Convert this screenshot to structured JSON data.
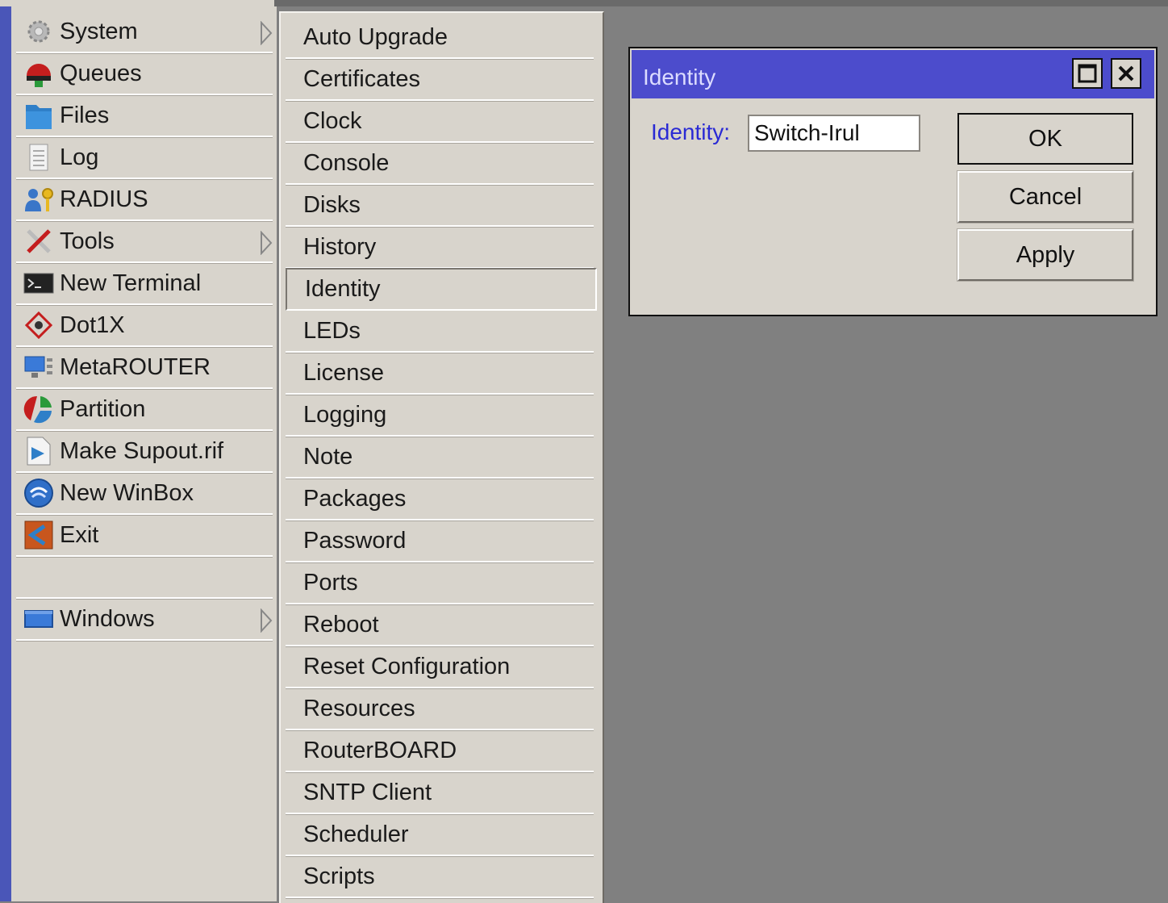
{
  "main_menu": {
    "items": [
      {
        "label": "System",
        "icon": "gear-icon",
        "has_submenu": true
      },
      {
        "label": "Queues",
        "icon": "queues-icon",
        "has_submenu": false
      },
      {
        "label": "Files",
        "icon": "folder-icon",
        "has_submenu": false
      },
      {
        "label": "Log",
        "icon": "log-icon",
        "has_submenu": false
      },
      {
        "label": "RADIUS",
        "icon": "radius-icon",
        "has_submenu": false
      },
      {
        "label": "Tools",
        "icon": "tools-icon",
        "has_submenu": true
      },
      {
        "label": "New Terminal",
        "icon": "terminal-icon",
        "has_submenu": false
      },
      {
        "label": "Dot1X",
        "icon": "dot1x-icon",
        "has_submenu": false
      },
      {
        "label": "MetaROUTER",
        "icon": "metarouter-icon",
        "has_submenu": false
      },
      {
        "label": "Partition",
        "icon": "partition-icon",
        "has_submenu": false
      },
      {
        "label": "Make Supout.rif",
        "icon": "supout-icon",
        "has_submenu": false
      },
      {
        "label": "New WinBox",
        "icon": "winbox-icon",
        "has_submenu": false
      },
      {
        "label": "Exit",
        "icon": "exit-icon",
        "has_submenu": false
      },
      {
        "label": "Windows",
        "icon": "windows-icon",
        "has_submenu": true
      }
    ]
  },
  "system_submenu": {
    "items": [
      "Auto Upgrade",
      "Certificates",
      "Clock",
      "Console",
      "Disks",
      "History",
      "Identity",
      "LEDs",
      "License",
      "Logging",
      "Note",
      "Packages",
      "Password",
      "Ports",
      "Reboot",
      "Reset Configuration",
      "Resources",
      "RouterBOARD",
      "SNTP Client",
      "Scheduler",
      "Scripts"
    ],
    "selected": "Identity"
  },
  "identity_dialog": {
    "title": "Identity",
    "field_label": "Identity:",
    "field_value": "Switch-Irul",
    "ok_label": "OK",
    "cancel_label": "Cancel",
    "apply_label": "Apply"
  },
  "colors": {
    "title_bar": "#4c4ccc",
    "field_label": "#2a2ad4",
    "panel": "#d8d4cc",
    "desktop": "#808080",
    "left_edge": "#4a56b8"
  }
}
